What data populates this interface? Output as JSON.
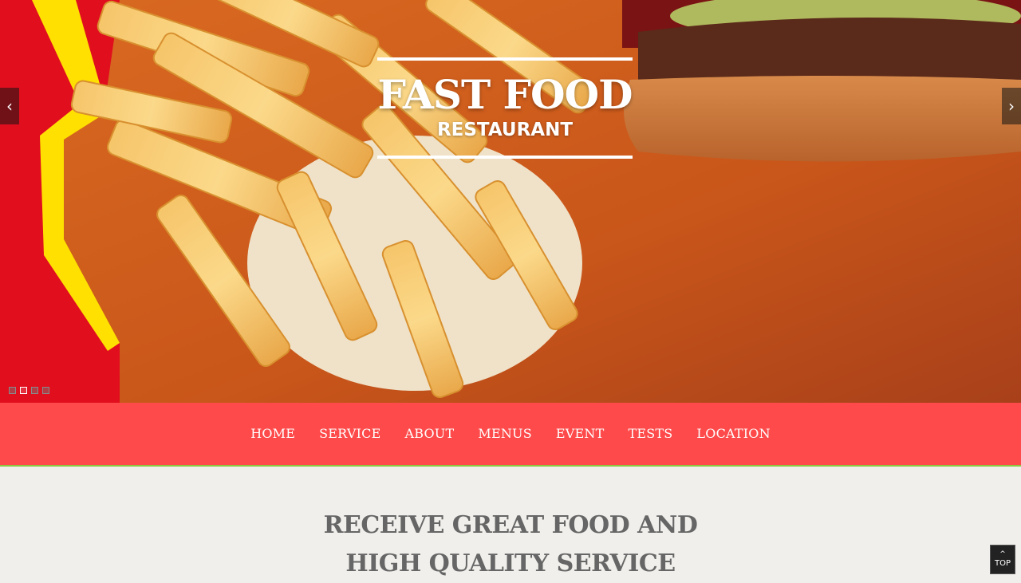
{
  "hero": {
    "title": "FAST FOOD",
    "subtitle": "RESTAURANT",
    "prev_arrow": "‹",
    "next_arrow": "›",
    "slides_total": 4,
    "active_slide": 2
  },
  "nav": {
    "items": [
      {
        "label": "HOME"
      },
      {
        "label": "SERVICE"
      },
      {
        "label": "ABOUT"
      },
      {
        "label": "MENUS"
      },
      {
        "label": "EVENT"
      },
      {
        "label": "TESTS"
      },
      {
        "label": "LOCATION"
      }
    ]
  },
  "intro": {
    "heading_line1": "RECEIVE GREAT FOOD AND",
    "heading_line2": "HIGH QUALITY SERVICE"
  },
  "back_to_top": {
    "arrow": "^",
    "label": "TOP"
  },
  "colors": {
    "nav_background": "#fe4a4a",
    "nav_border": "#8dc63f",
    "heading_text": "#666666",
    "page_background": "#f0efeb"
  }
}
